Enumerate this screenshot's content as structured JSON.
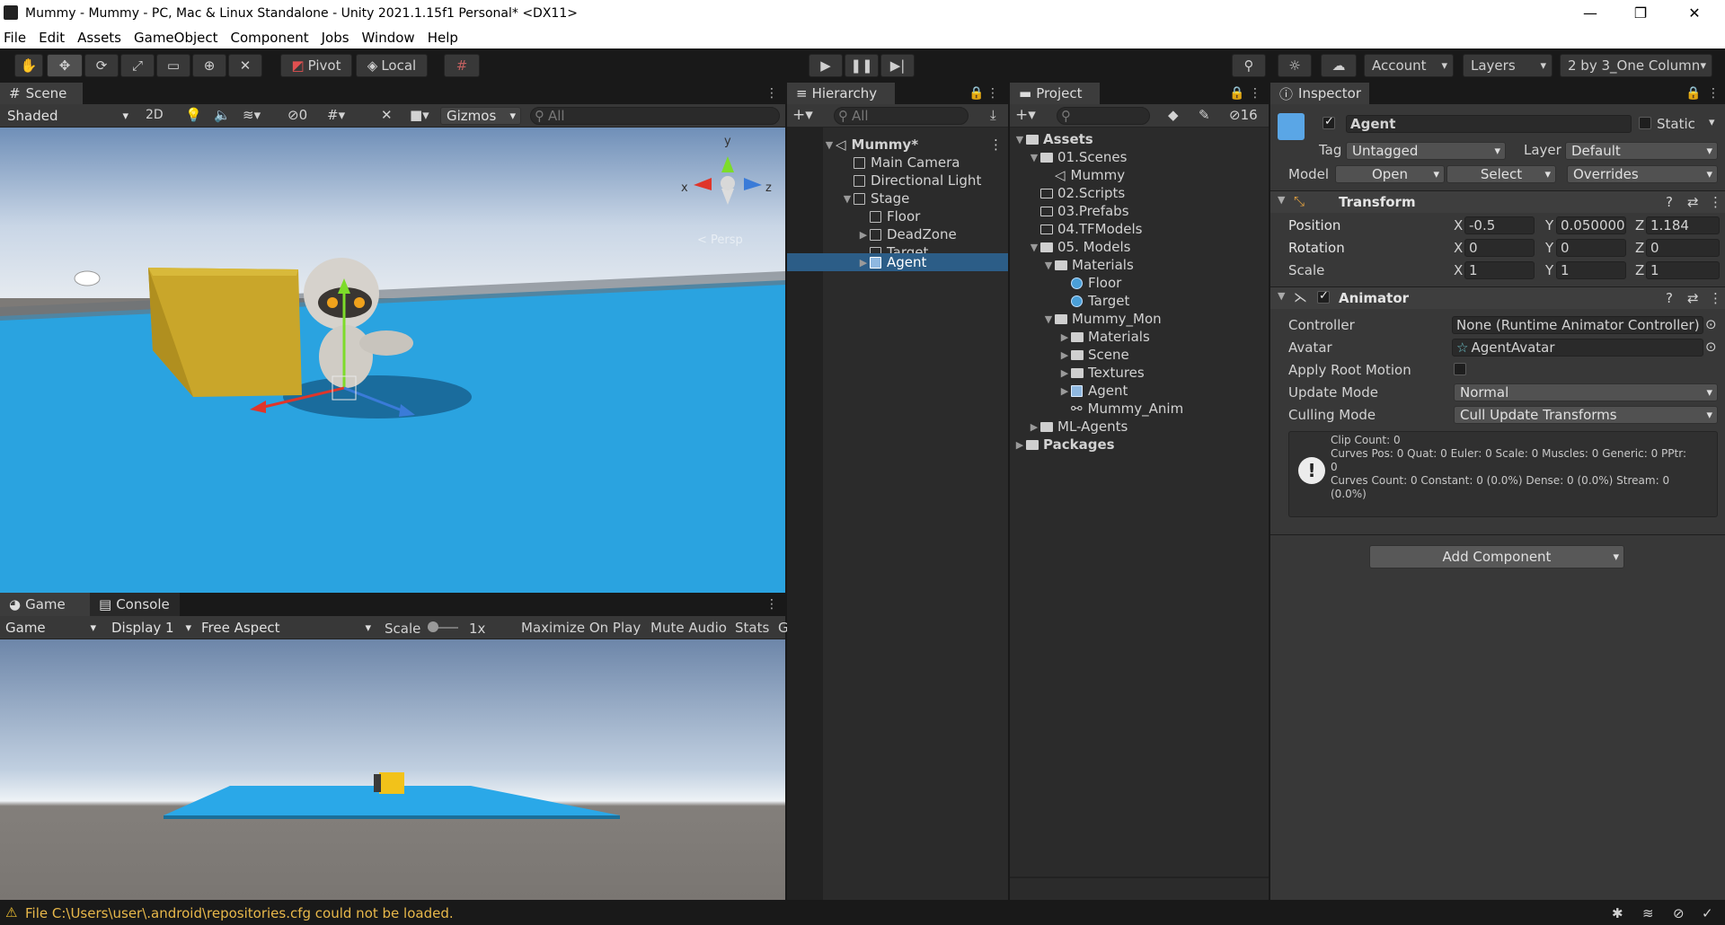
{
  "window": {
    "title": "Mummy - Mummy - PC, Mac & Linux Standalone - Unity 2021.1.15f1 Personal* <DX11>"
  },
  "menu": [
    "File",
    "Edit",
    "Assets",
    "GameObject",
    "Component",
    "Jobs",
    "Window",
    "Help"
  ],
  "toolbar": {
    "pivot": "Pivot",
    "local": "Local",
    "account": "Account",
    "layers": "Layers",
    "layout": "2 by 3_One Column"
  },
  "scene": {
    "tab": "Scene",
    "shading": "Shaded",
    "mode2d": "2D",
    "hidden_count": "0",
    "gizmos": "Gizmos",
    "search_placeholder": "All",
    "persp": "< Persp"
  },
  "game": {
    "tab_game": "Game",
    "tab_console": "Console",
    "view": "Game",
    "display": "Display 1",
    "aspect": "Free Aspect",
    "scale_label": "Scale",
    "scale_value": "1x",
    "maximize": "Maximize On Play",
    "mute": "Mute Audio",
    "stats": "Stats",
    "gizmos_cut": "G"
  },
  "hierarchy": {
    "tab": "Hierarchy",
    "search_placeholder": "All",
    "items": [
      {
        "label": "Mummy*",
        "bold": true
      },
      {
        "label": "Main Camera"
      },
      {
        "label": "Directional Light"
      },
      {
        "label": "Stage"
      },
      {
        "label": "Floor"
      },
      {
        "label": "DeadZone"
      },
      {
        "label": "Target"
      },
      {
        "label": "Agent"
      }
    ]
  },
  "project": {
    "tab": "Project",
    "hidden_count": "16",
    "items": [
      {
        "label": "Assets",
        "bold": true
      },
      {
        "label": "01.Scenes"
      },
      {
        "label": "Mummy"
      },
      {
        "label": "02.Scripts"
      },
      {
        "label": "03.Prefabs"
      },
      {
        "label": "04.TFModels"
      },
      {
        "label": "05. Models"
      },
      {
        "label": "Materials"
      },
      {
        "label": "Floor"
      },
      {
        "label": "Target"
      },
      {
        "label": "Mummy_Mon"
      },
      {
        "label": "Materials"
      },
      {
        "label": "Scene"
      },
      {
        "label": "Textures"
      },
      {
        "label": "Agent"
      },
      {
        "label": "Mummy_Anim"
      },
      {
        "label": "ML-Agents"
      },
      {
        "label": "Packages",
        "bold": true
      }
    ]
  },
  "inspector": {
    "tab": "Inspector",
    "object_name": "Agent",
    "static_label": "Static",
    "tag_label": "Tag",
    "tag_value": "Untagged",
    "layer_label": "Layer",
    "layer_value": "Default",
    "model_label": "Model",
    "open_btn": "Open",
    "select_btn": "Select",
    "overrides": "Overrides",
    "transform": {
      "title": "Transform",
      "position_label": "Position",
      "rotation_label": "Rotation",
      "scale_label": "Scale",
      "position": {
        "x": "-0.5",
        "y": "0.050000",
        "z": "1.184"
      },
      "rotation": {
        "x": "0",
        "y": "0",
        "z": "0"
      },
      "scale": {
        "x": "1",
        "y": "1",
        "z": "1"
      }
    },
    "animator": {
      "title": "Animator",
      "controller_label": "Controller",
      "controller_value": "None (Runtime Animator Controller)",
      "avatar_label": "Avatar",
      "avatar_value": "AgentAvatar",
      "root_motion_label": "Apply Root Motion",
      "update_mode_label": "Update Mode",
      "update_mode_value": "Normal",
      "culling_label": "Culling Mode",
      "culling_value": "Cull Update Transforms",
      "info_line1": "Clip Count: 0",
      "info_line2": "Curves Pos: 0 Quat: 0 Euler: 0 Scale: 0 Muscles: 0 Generic: 0 PPtr:",
      "info_line3": "0",
      "info_line4": "Curves Count: 0 Constant: 0 (0.0%) Dense: 0 (0.0%) Stream: 0",
      "info_line5": "(0.0%)"
    },
    "add_component": "Add Component"
  },
  "status": {
    "message": "File C:\\Users\\user\\.android\\repositories.cfg could not be loaded."
  }
}
